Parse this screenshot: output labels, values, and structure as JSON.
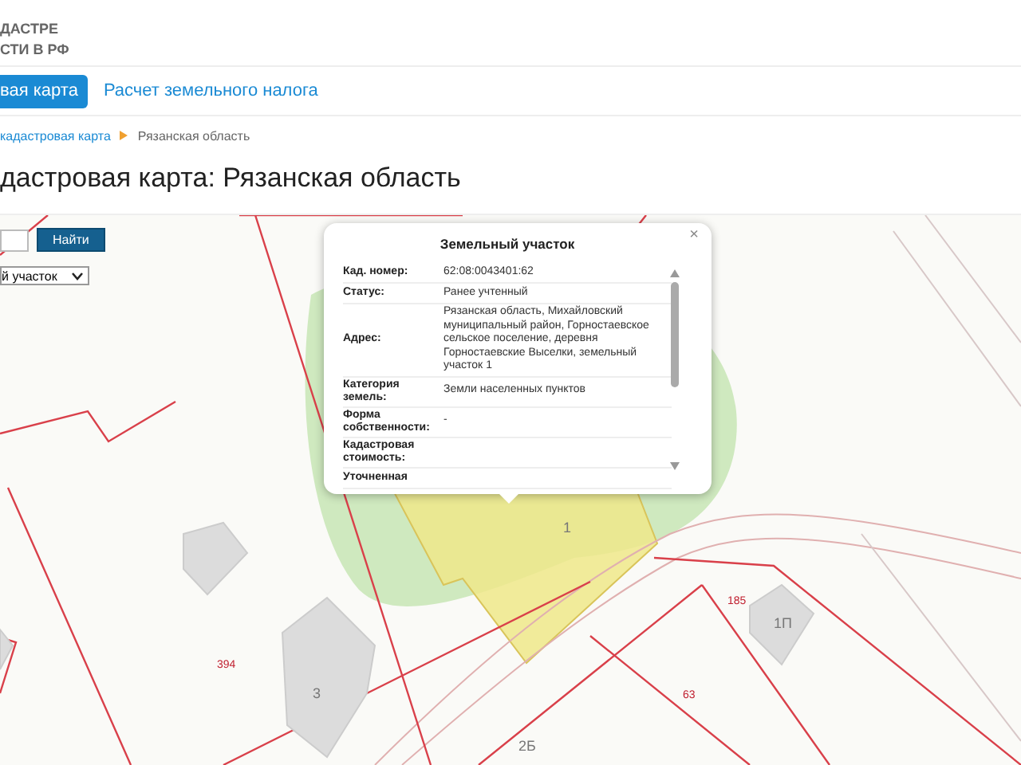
{
  "header": {
    "logo_lines": [
      "ДАСТРЕ",
      "СТИ В РФ"
    ]
  },
  "nav": {
    "tabs": [
      {
        "label": "вая карта",
        "selected": true
      },
      {
        "label": "Расчет земельного налога",
        "selected": false
      }
    ]
  },
  "breadcrumbs": [
    {
      "label": "кадастровая карта",
      "kind": "link"
    },
    {
      "label": "Рязанская область",
      "kind": "current"
    }
  ],
  "page_title": "дастровая карта: Рязанская область",
  "search": {
    "button": "Найти",
    "select_value": "й участок"
  },
  "map": {
    "labels": [
      {
        "text": "1",
        "kind": "building"
      },
      {
        "text": "185",
        "kind": "parcel"
      },
      {
        "text": "1П",
        "kind": "building"
      },
      {
        "text": "394",
        "kind": "parcel"
      },
      {
        "text": "3",
        "kind": "building"
      },
      {
        "text": "63",
        "kind": "parcel"
      },
      {
        "text": "2Б",
        "kind": "building"
      }
    ]
  },
  "popup": {
    "title": "Земельный участок",
    "close": "×",
    "rows": [
      {
        "label": "Кад. номер:",
        "value": "62:08:0043401:62"
      },
      {
        "label": "Статус:",
        "value": "Ранее учтенный"
      },
      {
        "label": "Адрес:",
        "value": "Рязанская область, Михайловский муниципальный район, Горностаевское сельское поселение, деревня Горностаевские Выселки, земельный участок 1"
      },
      {
        "label": "Категория земель:",
        "value": "Земли населенных пунктов"
      },
      {
        "label": "Форма собственности:",
        "value": "-"
      },
      {
        "label": "Кадастровая стоимость:"
      },
      {
        "label": "Уточненная"
      }
    ]
  }
}
